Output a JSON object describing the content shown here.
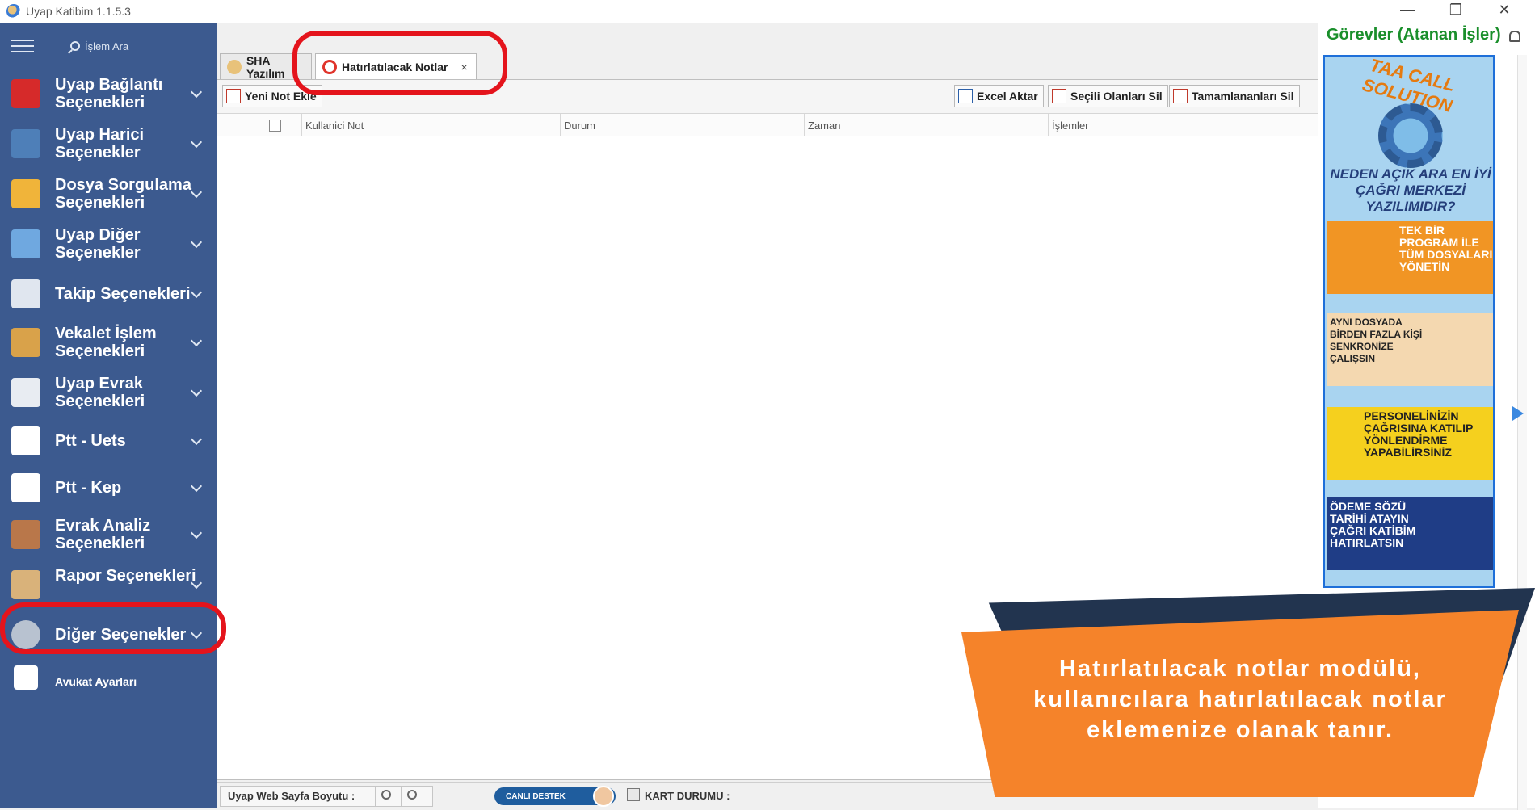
{
  "window": {
    "title": "Uyap Katibim 1.1.5.3",
    "controls": {
      "minimize": "—",
      "restore": "❐",
      "close": "✕"
    }
  },
  "sidebar": {
    "search_placeholder": "İşlem Ara",
    "items": [
      {
        "label": "Uyap Bağlantı Seçenekleri",
        "icon": "uyap-logo-icon",
        "color": "#d62a2a"
      },
      {
        "label": "Uyap Harici Seçenekler",
        "icon": "help-book-icon",
        "color": "#4e7fb8"
      },
      {
        "label": "Dosya Sorgulama Seçenekleri",
        "icon": "folder-icon",
        "color": "#f0b43a"
      },
      {
        "label": "Uyap Diğer Seçenekler",
        "icon": "grid-list-icon",
        "color": "#6fa8e0"
      },
      {
        "label": "Takip Seçenekleri",
        "icon": "window-icon",
        "color": "#e0e6ef"
      },
      {
        "label": "Vekalet İşlem Seçenekleri",
        "icon": "user-key-icon",
        "color": "#d9a24a"
      },
      {
        "label": "Uyap Evrak Seçenekleri",
        "icon": "document-icon",
        "color": "#e8ecf2"
      },
      {
        "label": "Ptt - Uets",
        "icon": "ptt-icon",
        "color": "#ffffff"
      },
      {
        "label": "Ptt - Kep",
        "icon": "ptt-icon",
        "color": "#ffffff"
      },
      {
        "label": "Evrak Analiz Seçenekleri",
        "icon": "briefcase-icon",
        "color": "#b9774a"
      },
      {
        "label": "Rapor Seçenekleri",
        "icon": "clipboard-icon",
        "color": "#d9b27a"
      },
      {
        "label": "Diğer Seçenekler",
        "icon": "gear-icon",
        "color": "#b8c2d0"
      },
      {
        "label": "Avukat Ayarları",
        "icon": "lawyer-id-icon",
        "color": "#ffffff"
      }
    ]
  },
  "tabs": [
    {
      "label": "SHA Yazılım",
      "active": false
    },
    {
      "label": "Hatırlatılacak Notlar",
      "active": true,
      "close": "×"
    }
  ],
  "toolbar": {
    "new_note": "Yeni Not Ekle",
    "excel_export": "Excel Aktar",
    "delete_selected": "Seçili Olanları Sil",
    "delete_completed": "Tamamlananları Sil"
  },
  "grid": {
    "columns": [
      "Kullanici Not",
      "Durum",
      "Zaman",
      "İşlemler"
    ],
    "rows": []
  },
  "statusbar": {
    "page_size_label": "Uyap Web Sayfa Boyutu :",
    "live_support": "CANLI DESTEK",
    "card_status_label": "KART DURUMU :"
  },
  "right_panel": {
    "title": "Görevler (Atanan İşler)",
    "banner": {
      "brand": "TAA CALL SOLUTION",
      "question": "NEDEN AÇIK ARA EN İYİ ÇAĞRI MERKEZİ YAZILIMIDIR?",
      "card1": "TEK BİR PROGRAM İLE TÜM DOSYALARI YÖNETİN",
      "card2": "AYNI DOSYADA BİRDEN FAZLA KİŞİ SENKRONİZE ÇALIŞSIN",
      "card3": "PERSONELİNİZİN ÇAĞRISINA KATILIP YÖNLENDİRME YAPABİLİRSİNİZ",
      "card4": "ÖDEME SÖZÜ TARİHİ ATAYIN ÇAĞRI KATİBİM HATIRLATSIN"
    }
  },
  "callout": {
    "text": "Hatırlatılacak notlar modülü, kullanıcılara hatırlatılacak notlar eklemenize olanak tanır."
  },
  "colors": {
    "sidebar_bg": "#3c5a8f",
    "highlight_ring": "#e4141c",
    "callout_orange": "#f5832a",
    "callout_navy": "#22344f",
    "gorevler_green": "#1a8f2b"
  }
}
